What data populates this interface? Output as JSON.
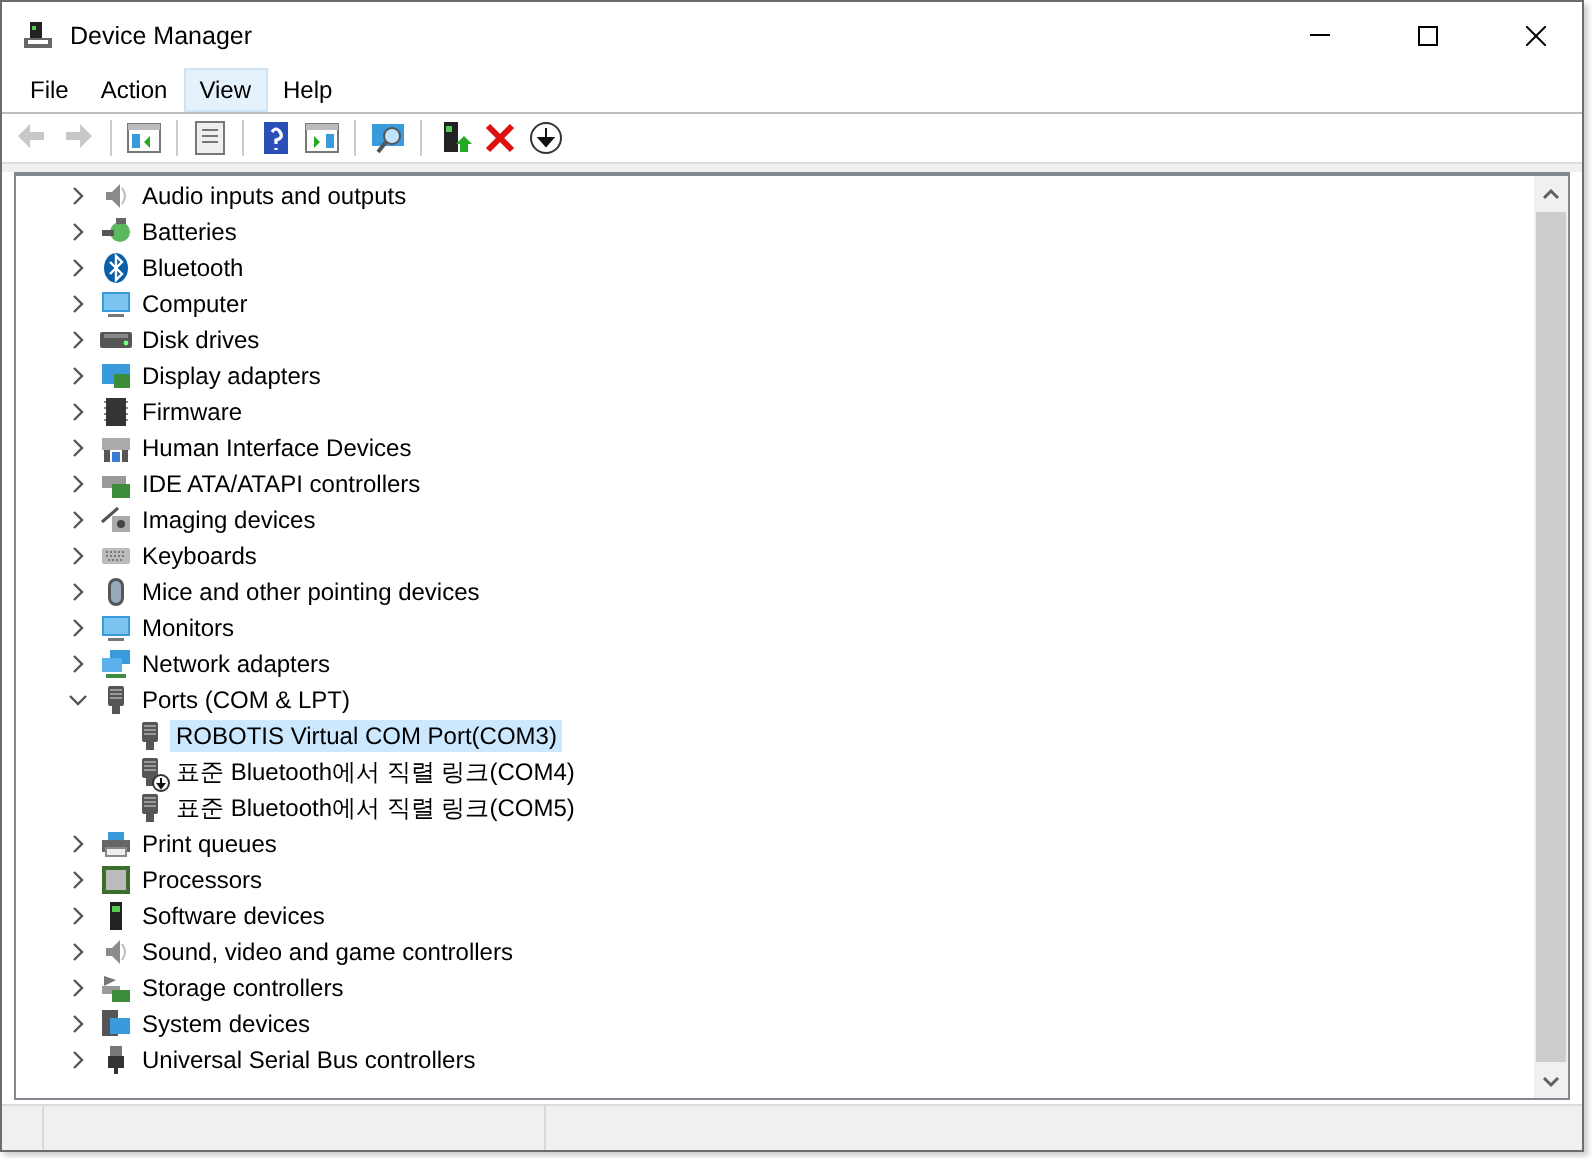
{
  "window": {
    "title": "Device Manager"
  },
  "menu": [
    {
      "label": "File",
      "selected": false
    },
    {
      "label": "Action",
      "selected": false
    },
    {
      "label": "View",
      "selected": true
    },
    {
      "label": "Help",
      "selected": false
    }
  ],
  "toolbar": [
    [
      {
        "kind": "back",
        "disabled": true
      },
      {
        "kind": "forward",
        "disabled": true
      }
    ],
    [
      {
        "kind": "console",
        "disabled": false
      }
    ],
    [
      {
        "kind": "properties",
        "disabled": false
      }
    ],
    [
      {
        "kind": "help",
        "disabled": false
      },
      {
        "kind": "action-pane",
        "disabled": false
      }
    ],
    [
      {
        "kind": "scan",
        "disabled": false
      }
    ],
    [
      {
        "kind": "update",
        "disabled": false
      },
      {
        "kind": "uninstall",
        "disabled": false
      },
      {
        "kind": "disable",
        "disabled": false
      }
    ]
  ],
  "tree": [
    {
      "label": "Audio inputs and outputs",
      "expanded": false,
      "selected": false
    },
    {
      "label": "Batteries",
      "expanded": false,
      "selected": false
    },
    {
      "label": "Bluetooth",
      "expanded": false,
      "selected": false
    },
    {
      "label": "Computer",
      "expanded": false,
      "selected": false
    },
    {
      "label": "Disk drives",
      "expanded": false,
      "selected": false
    },
    {
      "label": "Display adapters",
      "expanded": false,
      "selected": false
    },
    {
      "label": "Firmware",
      "expanded": false,
      "selected": false
    },
    {
      "label": "Human Interface Devices",
      "expanded": false,
      "selected": false
    },
    {
      "label": "IDE ATA/ATAPI controllers",
      "expanded": false,
      "selected": false
    },
    {
      "label": "Imaging devices",
      "expanded": false,
      "selected": false
    },
    {
      "label": "Keyboards",
      "expanded": false,
      "selected": false
    },
    {
      "label": "Mice and other pointing devices",
      "expanded": false,
      "selected": false
    },
    {
      "label": "Monitors",
      "expanded": false,
      "selected": false
    },
    {
      "label": "Network adapters",
      "expanded": false,
      "selected": false
    },
    {
      "label": "Ports (COM & LPT)",
      "expanded": true,
      "selected": false,
      "children": [
        {
          "label": "ROBOTIS Virtual COM Port(COM3)",
          "selected": true,
          "disabled": false
        },
        {
          "label": "표준 Bluetooth에서 직렬 링크(COM4)",
          "selected": false,
          "disabled": true
        },
        {
          "label": "표준 Bluetooth에서 직렬 링크(COM5)",
          "selected": false,
          "disabled": false
        }
      ]
    },
    {
      "label": "Print queues",
      "expanded": false,
      "selected": false
    },
    {
      "label": "Processors",
      "expanded": false,
      "selected": false
    },
    {
      "label": "Software devices",
      "expanded": false,
      "selected": false
    },
    {
      "label": "Sound, video and game controllers",
      "expanded": false,
      "selected": false
    },
    {
      "label": "Storage controllers",
      "expanded": false,
      "selected": false
    },
    {
      "label": "System devices",
      "expanded": false,
      "selected": false
    },
    {
      "label": "Universal Serial Bus controllers",
      "expanded": false,
      "selected": false
    }
  ]
}
